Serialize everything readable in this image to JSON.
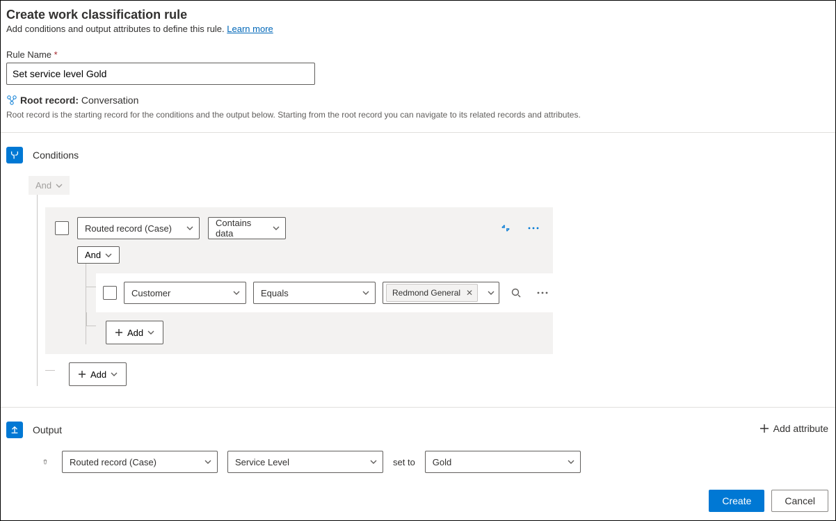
{
  "header": {
    "title": "Create work classification rule",
    "subtitle": "Add conditions and output attributes to define this rule.",
    "learn_more": "Learn more"
  },
  "rule_name": {
    "label": "Rule Name",
    "value": "Set service level Gold"
  },
  "root_record": {
    "label": "Root record:",
    "value": "Conversation",
    "help": "Root record is the starting record for the conditions and the output below. Starting from the root record you can navigate to its related records and attributes."
  },
  "conditions": {
    "section_label": "Conditions",
    "root_operator": "And",
    "group1": {
      "field": "Routed record (Case)",
      "operator": "Contains data",
      "sub_operator": "And",
      "inner": {
        "field": "Customer",
        "operator": "Equals",
        "value": "Redmond General"
      },
      "add_inner": "Add"
    },
    "add_outer": "Add"
  },
  "output": {
    "section_label": "Output",
    "add_attribute": "Add attribute",
    "row": {
      "entity": "Routed record (Case)",
      "attribute": "Service Level",
      "set_to_label": "set to",
      "value": "Gold"
    }
  },
  "footer": {
    "create": "Create",
    "cancel": "Cancel"
  }
}
